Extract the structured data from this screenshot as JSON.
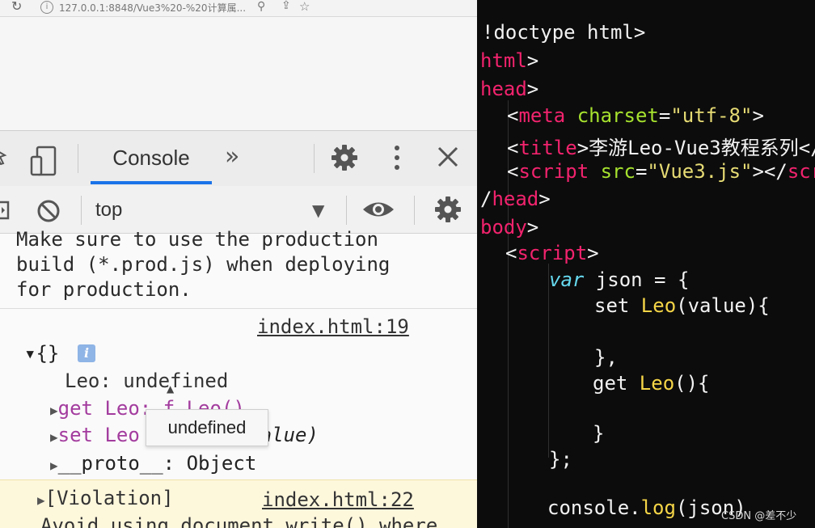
{
  "browser": {
    "url": "127.0.0.1:8848/Vue3%20-%20计算属..."
  },
  "devtools": {
    "tabs": [
      {
        "label": "Console"
      }
    ],
    "more_tabs": "»",
    "context": "top",
    "console": {
      "message_lines": [
        "Make sure to use the production",
        "build (*.prod.js) when deploying",
        "for production."
      ],
      "source1": "index.html:19",
      "object_brace": "{}",
      "object_info": "i",
      "prop_leo": "Leo: undefined",
      "getter_kw": "get",
      "getter_rest": " Leo: f Leo()",
      "setter_kw": "set",
      "setter_name": " Leo",
      "setter_arg": "(value)",
      "proto": "__proto__: Object",
      "tooltip": "undefined",
      "violation": "[Violation]",
      "source2": "index.html:22",
      "cut_line": "Avoid using document.write() where"
    }
  },
  "editor": {
    "lines": {
      "l1": "!doctype html>",
      "l2_tag": "html",
      "l3_tag": "head",
      "l4_tag": "meta",
      "l4_attr": "charset",
      "l4_val": "\"utf-8\"",
      "l5_tag": "title",
      "l5_text": "李游Leo-Vue3教程系列",
      "l6_tag": "script",
      "l6_attr": "src",
      "l6_val": "\"Vue3.js\"",
      "l7_tag": "head",
      "l8_tag": "body",
      "l9_tag": "script",
      "l10_kw": "var",
      "l10_rest": " json = {",
      "l11_a": "set ",
      "l11_fn": "Leo",
      "l11_b": "(value){",
      "l12": "},",
      "l13_a": "get ",
      "l13_fn": "Leo",
      "l13_b": "(){",
      "l14": "}",
      "l15": "};",
      "l16_a": "console.",
      "l16_fn": "log",
      "l16_b": "(json)"
    }
  },
  "watermark": "CSDN @差不少"
}
